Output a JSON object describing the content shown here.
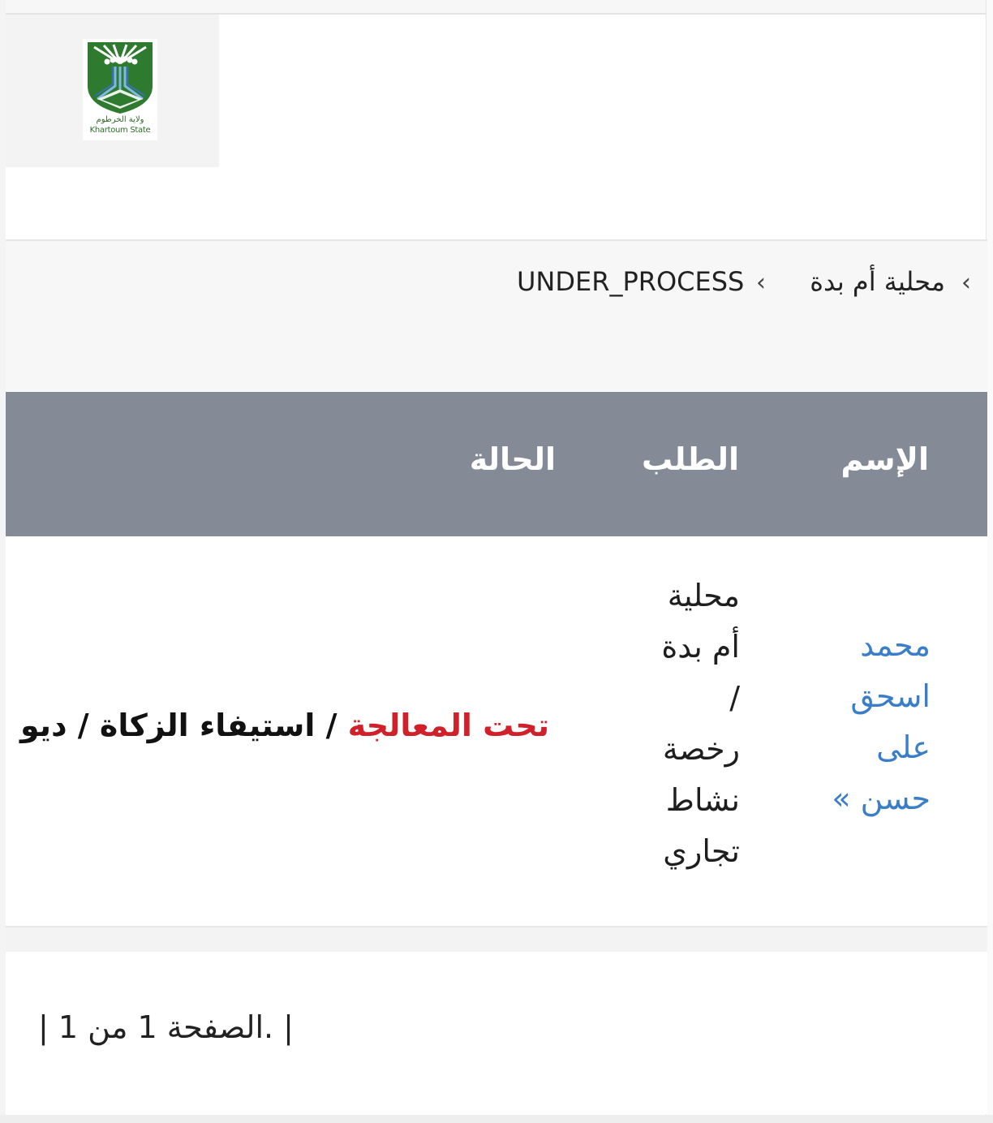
{
  "logo": {
    "arabic_text": "ولاية الخرطوم",
    "english_text": "Khartoum State",
    "colors": {
      "green": "#2e7a2e",
      "blue": "#3a6fb5"
    }
  },
  "breadcrumb": {
    "chevron_icon": "chevron-left-icon",
    "items": [
      {
        "label": "محلية أم بدة"
      },
      {
        "label": "UNDER_PROCESS"
      }
    ]
  },
  "table": {
    "header_bg": "#858b96",
    "columns": [
      {
        "label": "الإسم"
      },
      {
        "label": "الطلب"
      },
      {
        "label": "الحالة"
      }
    ],
    "rows": [
      {
        "name_lines": [
          "محمد",
          "اسحق",
          "على",
          "حسن »"
        ],
        "request_lines": [
          "محلية",
          "أم بدة",
          "/",
          "رخصة",
          "نشاط",
          "تجاري"
        ],
        "status_red": "تحت المعالجة",
        "status_rest": " / استيفاء الزكاة / ديو"
      }
    ]
  },
  "pager": {
    "text": "|  الصفحة 1 من 1.  |"
  }
}
